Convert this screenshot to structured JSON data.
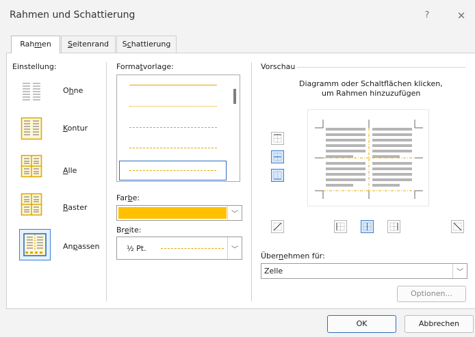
{
  "window": {
    "title": "Rahmen und Schattierung",
    "help": "?",
    "close": "✕"
  },
  "tabs": [
    {
      "pre": "Rah",
      "u": "m",
      "post": "en"
    },
    {
      "pre": "",
      "u": "S",
      "post": "eitenrand"
    },
    {
      "pre": "S",
      "u": "c",
      "post": "hattierung"
    }
  ],
  "setting": {
    "label": "Einstellung:",
    "presets": [
      {
        "pre": "O",
        "u": "h",
        "post": "ne"
      },
      {
        "pre": "",
        "u": "K",
        "post": "ontur"
      },
      {
        "pre": "",
        "u": "A",
        "post": "lle"
      },
      {
        "pre": "",
        "u": "R",
        "post": "aster"
      },
      {
        "pre": "An",
        "u": "p",
        "post": "assen"
      }
    ]
  },
  "format": {
    "label_pre": "Forma",
    "label_u": "t",
    "label_post": "vorlage:",
    "color_label_pre": "Far",
    "color_label_u": "b",
    "color_label_post": "e:",
    "color_value": "#ffc000",
    "width_label_pre": "Br",
    "width_label_u": "e",
    "width_label_post": "ite:",
    "width_value": "½ Pt."
  },
  "preview": {
    "label": "Vorschau",
    "hint_line1": "Diagramm oder Schaltflächen klicken,",
    "hint_line2": "um Rahmen hinzuzufügen",
    "apply_label_pre": "Über",
    "apply_label_u": "n",
    "apply_label_post": "ehmen für:",
    "apply_value": "Zelle",
    "options_button": "Optionen..."
  },
  "footer": {
    "ok": "OK",
    "cancel": "Abbrechen"
  },
  "colors": {
    "accent": "#2b6bbd",
    "border_color": "#e0a800"
  }
}
